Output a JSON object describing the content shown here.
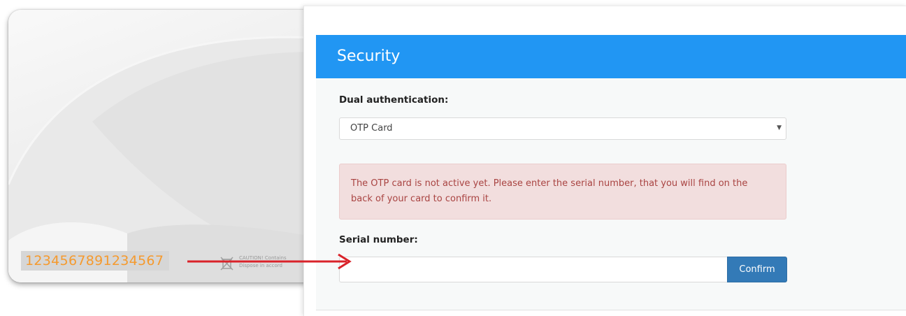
{
  "card": {
    "serial_number": "1234567891234567",
    "caution_line1": "CAUTION! Contains",
    "caution_line2": "Dispose in accord"
  },
  "security": {
    "title": "Security",
    "dual_auth_label": "Dual authentication:",
    "dual_auth_selected": "OTP Card",
    "alert_text": "The OTP card is not active yet. Please enter the serial number, that you will find on the back of your card to confirm it.",
    "serial_label": "Serial number:",
    "serial_value": "",
    "confirm_label": "Confirm"
  },
  "colors": {
    "header": "#2196f3",
    "alert_bg": "#f2dede",
    "alert_text": "#a94442",
    "button": "#337ab7",
    "arrow": "#d9232a",
    "serial_text": "#f59a2e"
  },
  "icons": {
    "select": "caret-down-icon",
    "arrow": "arrow-right-icon",
    "bin": "crossed-bin-icon"
  }
}
